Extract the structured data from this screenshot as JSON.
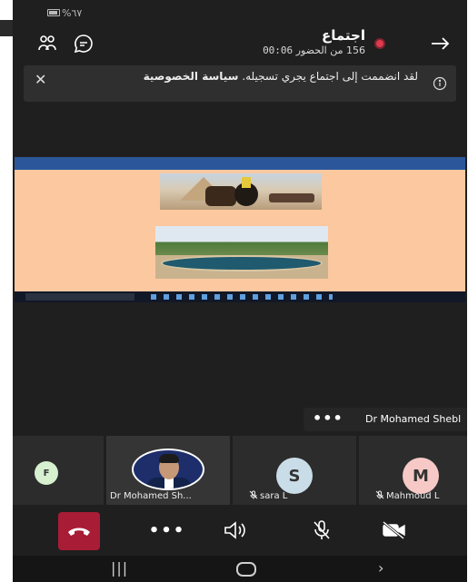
{
  "status_bar": {
    "battery": "%٦٧"
  },
  "meeting": {
    "title": "اجتماع",
    "timer": "00:06",
    "attendance": "156 من الحضور"
  },
  "banner": {
    "message": "لقد انضممت إلى اجتماع يجري تسجيله.",
    "link": "سياسة الخصوصية"
  },
  "shared_screen": {
    "document": "word-slide",
    "accent": "#2b579a",
    "background": "#fcc8a0"
  },
  "active_speaker": {
    "more": "•••",
    "name": "Dr Mohamed Shebl"
  },
  "participants": [
    {
      "initial": "F",
      "name": ""
    },
    {
      "initial": "",
      "name": "Dr Mohamed Sh..."
    },
    {
      "initial": "S",
      "name": "sara L"
    },
    {
      "initial": "M",
      "name": "Mahmoud L"
    }
  ],
  "controls": {
    "more": "•••",
    "end_call_color": "#a81c36",
    "icons": [
      "phone-hangup-icon",
      "more-icon",
      "speaker-icon",
      "mic-off-icon",
      "video-off-icon"
    ]
  },
  "nav": {
    "recent": "|||",
    "back": "›"
  },
  "colors": {
    "record": "#e03a4e",
    "background": "#1f1f1f"
  }
}
